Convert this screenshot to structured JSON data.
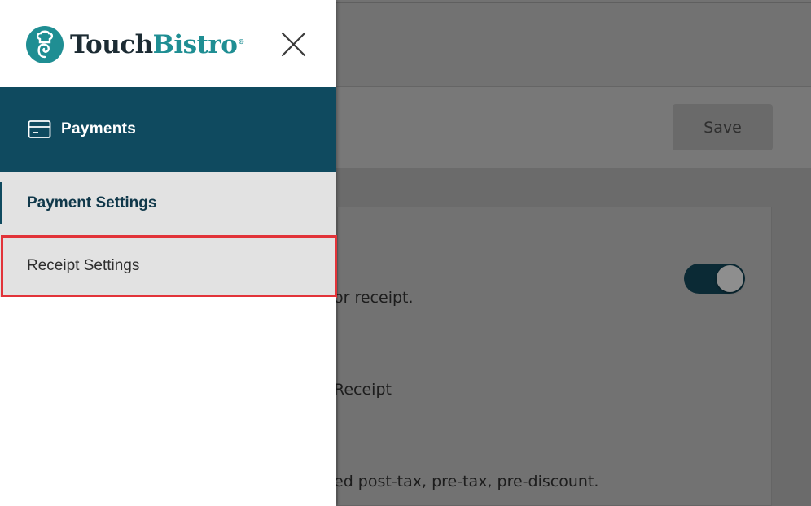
{
  "background": {
    "save_label": "Save",
    "texts": [
      "or receipt.",
      "Receipt",
      "ed post-tax, pre-tax, pre-discount."
    ],
    "toggle_on": true
  },
  "drawer": {
    "logo": {
      "part1": "Touch",
      "part2": "Bistro",
      "reg": "®"
    },
    "close_icon": "close-icon",
    "section": {
      "label": "Payments",
      "icon": "credit-card-icon"
    },
    "items": [
      {
        "label": "Payment Settings",
        "active": true
      },
      {
        "label": "Receipt Settings",
        "active": false
      }
    ]
  },
  "colors": {
    "brand_teal": "#1f8e93",
    "header_navy": "#0f4a5f",
    "highlight_red": "#e23339",
    "nav_bg": "#e2e2e2"
  }
}
